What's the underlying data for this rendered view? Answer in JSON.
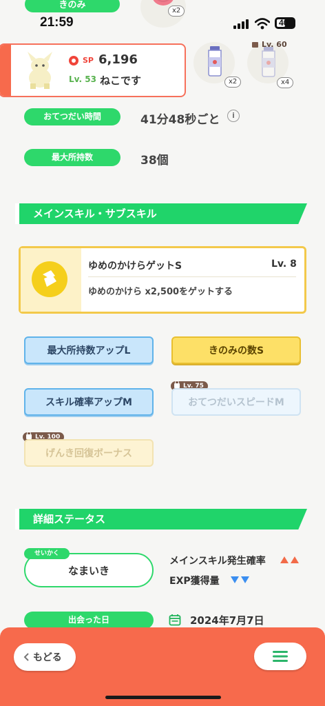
{
  "status_bar": {
    "time": "21:59",
    "battery": "40"
  },
  "top": {
    "berry_label": "きのみ",
    "berry_count": "x2"
  },
  "pokemon": {
    "sp_label": "SP",
    "sp_value": "6,196",
    "level": "Lv. 53",
    "name": "ねこです"
  },
  "items": [
    {
      "count": "x2"
    },
    {
      "count": "x4",
      "lock_level": "Lv. 60"
    }
  ],
  "info": {
    "help_time_label": "おてつだい時間",
    "help_time_value": "41分48秒ごと",
    "max_carry_label": "最大所持数",
    "max_carry_value": "38個"
  },
  "skills_section": {
    "title": "メインスキル・サブスキル",
    "main_skill": {
      "name": "ゆめのかけらゲットS",
      "level": "Lv. 8",
      "description": "ゆめのかけら x2,500をゲットする"
    },
    "sub_skills": [
      {
        "label": "最大所持数アップL",
        "style": "blue",
        "locked": false
      },
      {
        "label": "きのみの数S",
        "style": "yellow",
        "locked": false
      },
      {
        "label": "スキル確率アップM",
        "style": "blue",
        "locked": false
      },
      {
        "label": "おてつだいスピードM",
        "style": "blue",
        "locked": true,
        "lock_level": "Lv. 75"
      },
      {
        "label": "げんき回復ボーナス",
        "style": "yellow",
        "locked": true,
        "lock_level": "Lv. 100"
      }
    ]
  },
  "details_section": {
    "title": "詳細ステータス",
    "nature_tag": "せいかく",
    "nature": "なまいき",
    "main_skill_rate_label": "メインスキル発生確率",
    "exp_label": "EXP獲得量",
    "met_date_label": "出会った日",
    "met_date": "2024年7月7日"
  },
  "footer": {
    "back_label": "もどる"
  },
  "colors": {
    "green": "#2ed86b",
    "orange": "#f76a4c",
    "up": "#f26b48",
    "down": "#3b8ef0"
  }
}
